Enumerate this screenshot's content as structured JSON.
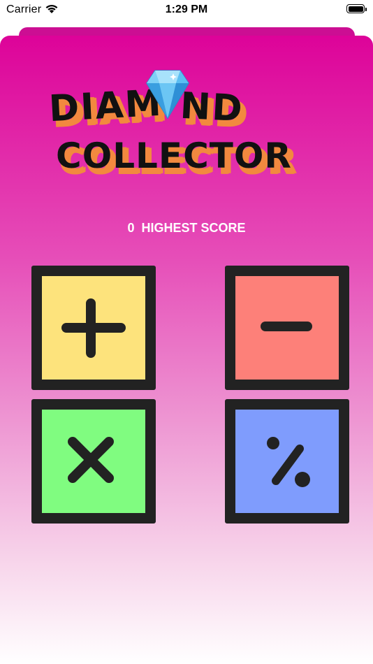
{
  "status_bar": {
    "carrier": "Carrier",
    "time": "1:29 PM",
    "icons": [
      "wifi-icon",
      "battery-icon"
    ]
  },
  "logo": {
    "word1": "DIAM",
    "word2": "ND",
    "word3": "COLLECTOR",
    "icon": "diamond-icon",
    "text_color": "#111111",
    "shadow_color": "#f2893f"
  },
  "score": {
    "value": "0",
    "label": "HIGHEST SCORE"
  },
  "operations": [
    {
      "name": "addition",
      "icon": "plus-icon",
      "color": "#fde37c"
    },
    {
      "name": "subtraction",
      "icon": "minus-icon",
      "color": "#fd8079"
    },
    {
      "name": "multiplication",
      "icon": "times-icon",
      "color": "#80fc80"
    },
    {
      "name": "division",
      "icon": "percent-icon",
      "color": "#7f9cfd"
    }
  ],
  "colors": {
    "gradient_top": "#dd0399",
    "gradient_bottom": "#ffffff",
    "tile_border": "#222222"
  }
}
